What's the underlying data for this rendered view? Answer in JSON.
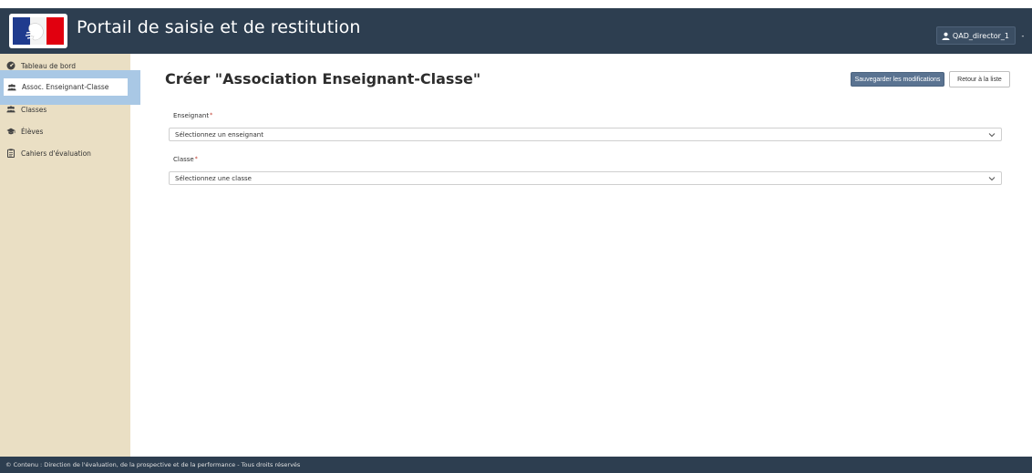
{
  "header": {
    "app_title": "Portail de saisie et de restitution",
    "user_label": "QAD_director_1",
    "user_caret": "-",
    "background": "#2d3e50"
  },
  "sidebar": {
    "background": "#eadfc4",
    "items": [
      {
        "label": "Tableau de bord",
        "icon": "dashboard-icon"
      },
      {
        "label": "Assoc. Enseignant-Classe",
        "icon": "users-icon",
        "active": true
      },
      {
        "label": "Classes",
        "icon": "users-icon"
      },
      {
        "label": "Élèves",
        "icon": "graduation-cap-icon"
      },
      {
        "label": "Cahiers d'évaluation",
        "icon": "clipboard-icon"
      }
    ]
  },
  "main": {
    "title": "Créer \"Association Enseignant-Classe\"",
    "save_button": "Sauvegarder les modifications",
    "back_button": "Retour à la liste",
    "fields": [
      {
        "label": "Enseignant",
        "required_mark": "*",
        "placeholder": "Sélectionnez un enseignant"
      },
      {
        "label": "Classe",
        "required_mark": "*",
        "placeholder": "Sélectionnez une classe"
      }
    ]
  },
  "footer": {
    "text": "© Contenu : Direction de l'évaluation, de la prospective et de la performance - Tous droits réservés"
  },
  "colors": {
    "accent": "#5a7391",
    "active_highlight": "#a9c8e5",
    "required": "#c0392b"
  }
}
